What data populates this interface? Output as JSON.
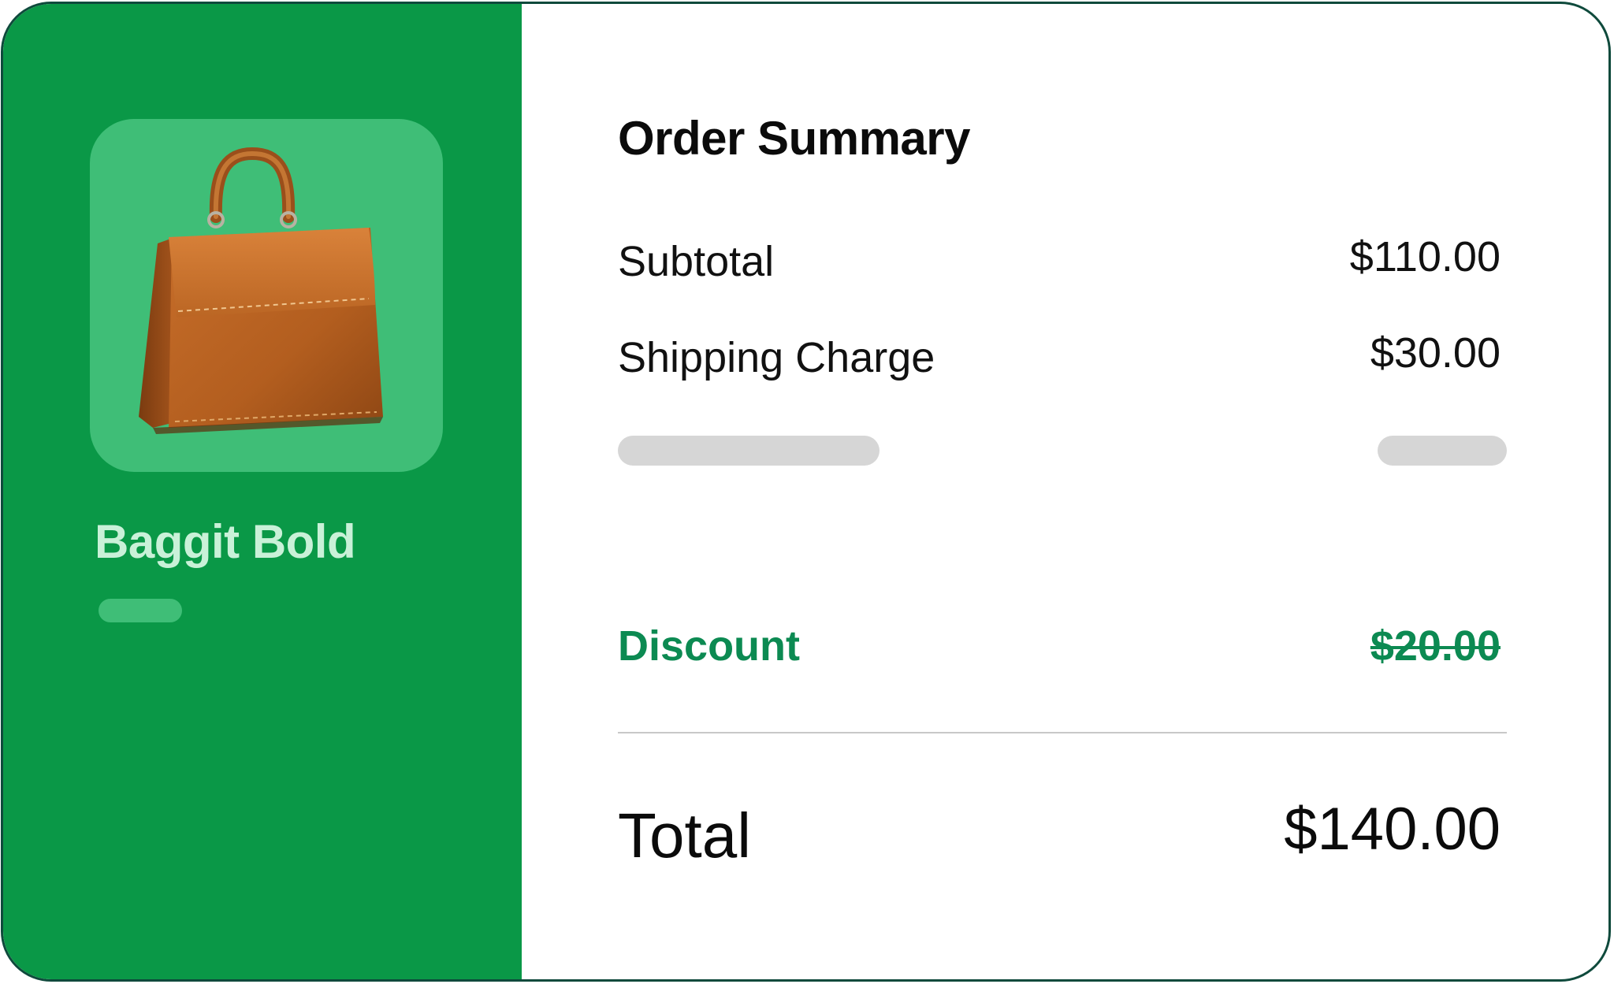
{
  "product": {
    "name": "Baggit Bold",
    "image_icon": "handbag-icon"
  },
  "summary": {
    "title": "Order Summary",
    "subtotal_label": "Subtotal",
    "subtotal_value": "$110.00",
    "shipping_label": "Shipping Charge",
    "shipping_value": "$30.00",
    "discount_label": "Discount",
    "discount_value": "$20.00",
    "total_label": "Total",
    "total_value": "$140.00"
  },
  "colors": {
    "panel_green": "#0a9847",
    "tile_green": "#3fbe77",
    "product_name": "#c9f1d8",
    "discount_green": "#0c8a52",
    "border": "#0f4a3c",
    "skeleton": "#d6d6d6"
  }
}
